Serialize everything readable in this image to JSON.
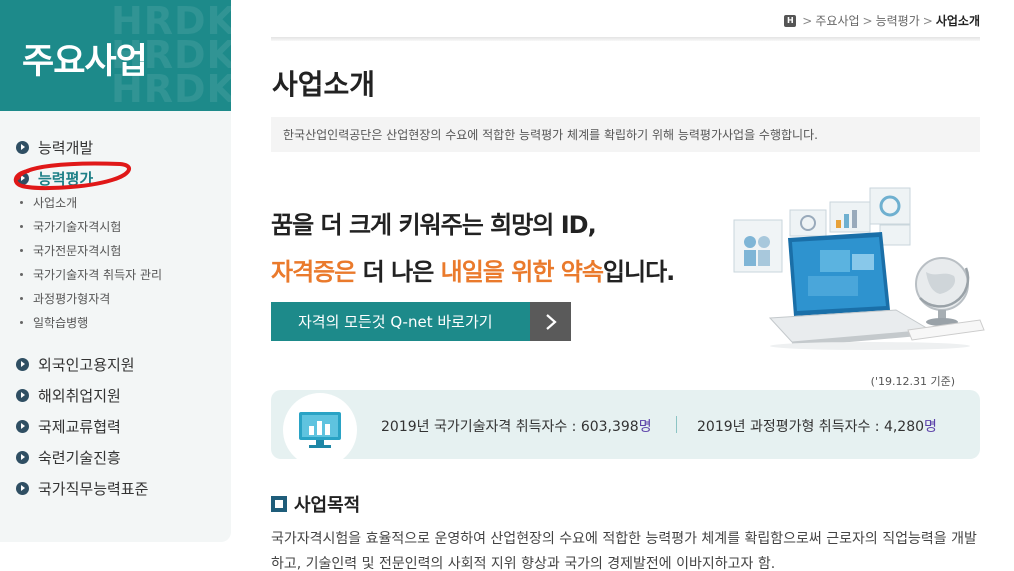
{
  "sidebar": {
    "title": "주요사업",
    "items": [
      {
        "label": "능력개발"
      },
      {
        "label": "능력평가"
      },
      {
        "label": "외국인고용지원"
      },
      {
        "label": "해외취업지원"
      },
      {
        "label": "국제교류협력"
      },
      {
        "label": "숙련기술진흥"
      },
      {
        "label": "국가직무능력표준"
      }
    ],
    "subitems": [
      {
        "label": "사업소개"
      },
      {
        "label": "국가기술자격시험"
      },
      {
        "label": "국가전문자격시험"
      },
      {
        "label": "국가기술자격 취득자 관리"
      },
      {
        "label": "과정평가형자격"
      },
      {
        "label": "일학습병행"
      }
    ]
  },
  "breadcrumb": {
    "home_icon": "H",
    "items": [
      "주요사업",
      "능력평가",
      "사업소개"
    ],
    "separator": ">"
  },
  "page": {
    "title": "사업소개",
    "intro": "한국산업인력공단은 산업현장의 수요에 적합한 능력평가 체계를 확립하기 위해 능력평가사업을 수행합니다."
  },
  "hero": {
    "line1": "꿈을 더 크게 키워주는 희망의 ID,",
    "line2_orange1": "자격증은",
    "line2_mid": " 더 나은 ",
    "line2_orange2": "내일을 위한 약속",
    "line2_end": "입니다.",
    "button_label": "자격의 모든것 Q-net 바로가기"
  },
  "stats": {
    "as_of": "('19.12.31 기준)",
    "stat1_label": "2019년 국가기술자격 취득자수 : 603,398",
    "stat1_unit": "명",
    "stat2_label": "2019년 과정평가형 취득자수 : 4,280",
    "stat2_unit": "명"
  },
  "section": {
    "title": "사업목적",
    "body": "국가자격시험을 효율적으로 운영하여 산업현장의 수요에 적합한 능력평가 체계를 확립함으로써 근로자의 직업능력을 개발하고, 기술인력 및 전문인력의 사회적 지위 향상과 국가의 경제발전에 이바지하고자 함."
  },
  "colors": {
    "accent": "#1d8a8a",
    "orange": "#ea7a2c",
    "annotation": "#e01818"
  }
}
